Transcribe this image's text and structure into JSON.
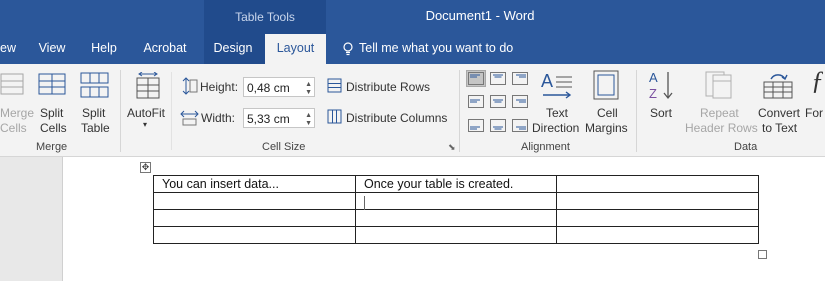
{
  "titlebar": {
    "context_tab": "Table Tools",
    "document_title": "Document1  -  Word"
  },
  "tabs": [
    {
      "label": "ew"
    },
    {
      "label": "View"
    },
    {
      "label": "Help"
    },
    {
      "label": "Acrobat"
    },
    {
      "label": "Design"
    },
    {
      "label": "Layout"
    },
    {
      "label": "Tell me what you want to do"
    }
  ],
  "merge_group": {
    "label": "Merge",
    "merge_cells": [
      "Merge",
      "Cells"
    ],
    "split_cells": [
      "Split",
      "Cells"
    ],
    "split_table": [
      "Split",
      "Table"
    ]
  },
  "cell_size_group": {
    "label": "Cell Size",
    "autofit": "AutoFit",
    "height_label": "Height:",
    "height_value": "0,48 cm",
    "width_label": "Width:",
    "width_value": "5,33 cm",
    "distribute_rows": "Distribute Rows",
    "distribute_columns": "Distribute Columns"
  },
  "alignment_group": {
    "label": "Alignment",
    "text_direction": [
      "Text",
      "Direction"
    ],
    "cell_margins": [
      "Cell",
      "Margins"
    ]
  },
  "data_group": {
    "label": "Data",
    "sort": "Sort",
    "repeat_header": [
      "Repeat",
      "Header Rows"
    ],
    "convert": [
      "Convert",
      "to Text"
    ],
    "formula": "For"
  },
  "document": {
    "table": [
      [
        "You can insert data...",
        "Once your table is created.",
        ""
      ],
      [
        "",
        "",
        ""
      ],
      [
        "",
        "",
        ""
      ],
      [
        "",
        "",
        ""
      ]
    ]
  },
  "colors": {
    "word_blue": "#2b579a",
    "context_blue": "#214b8c",
    "ribbon_bg": "#f3f3f3"
  }
}
